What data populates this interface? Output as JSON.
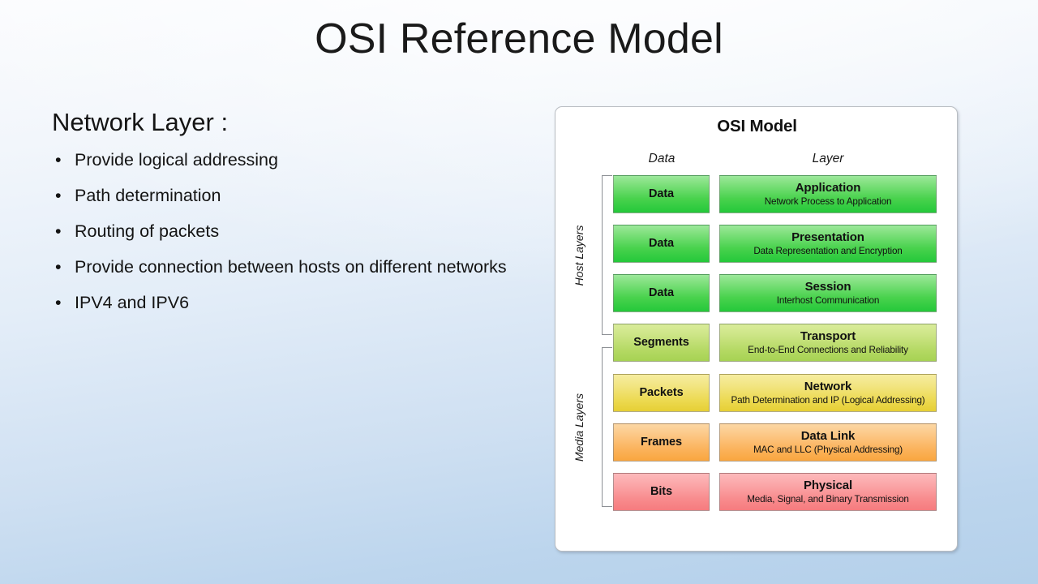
{
  "slide": {
    "title": "OSI Reference Model"
  },
  "left": {
    "heading": "Network Layer :",
    "bullet_marker": "•",
    "bullets": [
      "Provide logical addressing",
      "Path determination",
      "Routing of packets",
      "Provide connection between hosts on different networks",
      "IPV4 and IPV6"
    ]
  },
  "osi": {
    "title": "OSI Model",
    "columns": {
      "data": "Data",
      "layer": "Layer"
    },
    "groups": [
      {
        "label": "Host Layers"
      },
      {
        "label": "Media Layers"
      }
    ],
    "colors": {
      "green": "#49d24d",
      "yellow_green": "#b5d964",
      "yellow": "#ecd94f",
      "orange": "#fbb25a",
      "red": "#f88b8d"
    },
    "rows": [
      {
        "data": "Data",
        "layer": "Application",
        "desc": "Network Process to Application",
        "color": "green",
        "group": "host"
      },
      {
        "data": "Data",
        "layer": "Presentation",
        "desc": "Data Representation and Encryption",
        "color": "green",
        "group": "host"
      },
      {
        "data": "Data",
        "layer": "Session",
        "desc": "Interhost Communication",
        "color": "green",
        "group": "host"
      },
      {
        "data": "Segments",
        "layer": "Transport",
        "desc": "End-to-End Connections and Reliability",
        "color": "yellow_green",
        "group": "host"
      },
      {
        "data": "Packets",
        "layer": "Network",
        "desc": "Path Determination and IP (Logical Addressing)",
        "color": "yellow",
        "group": "media"
      },
      {
        "data": "Frames",
        "layer": "Data Link",
        "desc": "MAC and LLC (Physical Addressing)",
        "color": "orange",
        "group": "media"
      },
      {
        "data": "Bits",
        "layer": "Physical",
        "desc": "Media, Signal, and Binary Transmission",
        "color": "red",
        "group": "media"
      }
    ]
  }
}
